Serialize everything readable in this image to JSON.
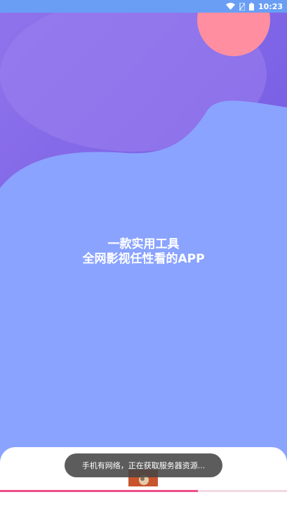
{
  "status_bar": {
    "time": "10:23",
    "icons": [
      "wifi-icon",
      "no-sim-icon",
      "battery-icon"
    ]
  },
  "splash": {
    "line1": "一款实用工具",
    "line2": "全网影视任性看的APP",
    "colors": {
      "background_top": "#7a63e8",
      "wave": "#8aa3ff",
      "sun": "#ff8fa0",
      "status_bar": "#6a9ef5"
    }
  },
  "toast": {
    "message": "手机有网络，正在获取服务器资源..."
  },
  "loading": {
    "progress_fraction": 0.69,
    "bar_color": "#ee4f8b"
  }
}
